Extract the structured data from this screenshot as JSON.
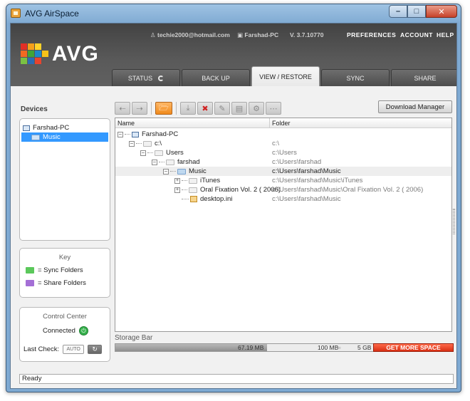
{
  "window": {
    "title": "AVG AirSpace"
  },
  "header": {
    "logo_text": "AVG",
    "account_email": "techie2000@hotmail.com",
    "computer_name": "Farshad-PC",
    "version": "V. 3.7.10770",
    "links": {
      "preferences": "PREFERENCES",
      "account": "ACCOUNT",
      "help": "HELP"
    }
  },
  "tabs": [
    {
      "label": "STATUS",
      "active": false
    },
    {
      "label": "BACK UP",
      "active": false
    },
    {
      "label": "VIEW / RESTORE",
      "active": true
    },
    {
      "label": "SYNC",
      "active": false
    },
    {
      "label": "SHARE",
      "active": false
    }
  ],
  "devices": {
    "label": "Devices",
    "items": [
      {
        "label": "Farshad-PC",
        "icon": "computer-icon",
        "selected": false
      },
      {
        "label": "Music",
        "icon": "folder-icon",
        "selected": true
      }
    ]
  },
  "key": {
    "title": "Key",
    "items": [
      {
        "label": "= Sync Folders",
        "color": "#5bc85b"
      },
      {
        "label": "= Share Folders",
        "color": "#a46fd6"
      }
    ]
  },
  "control_center": {
    "title": "Control Center",
    "status": "Connected",
    "last_check_label": "Last Check:",
    "auto_label": "AUTO"
  },
  "toolbar": {
    "download_manager": "Download Manager"
  },
  "listview": {
    "columns": [
      "Name",
      "Folder"
    ],
    "rows": [
      {
        "name": "Farshad-PC",
        "folder": "",
        "type": "computer",
        "selected": false
      },
      {
        "name": "c:\\",
        "folder": "c:\\",
        "type": "folder",
        "selected": false
      },
      {
        "name": "Users",
        "folder": "c:\\Users",
        "type": "folder",
        "selected": false
      },
      {
        "name": "farshad",
        "folder": "c:\\Users\\farshad",
        "type": "folder",
        "selected": false
      },
      {
        "name": "Music",
        "folder": "c:\\Users\\farshad\\Music",
        "type": "folder-blue",
        "selected": true
      },
      {
        "name": "iTunes",
        "folder": "c:\\Users\\farshad\\Music\\iTunes",
        "type": "folder",
        "selected": false
      },
      {
        "name": "Oral Fixation Vol. 2 ( 2006)",
        "folder": "c:\\Users\\farshad\\Music\\Oral Fixation Vol. 2 ( 2006)",
        "type": "folder",
        "selected": false
      },
      {
        "name": "desktop.ini",
        "folder": "c:\\Users\\farshad\\Music",
        "type": "file",
        "selected": false
      }
    ]
  },
  "storage": {
    "label": "Storage Bar",
    "used": "67.19 MB",
    "mid": "100 MB",
    "max": "5 GB",
    "used_fraction_of_bar": 0.45,
    "more_space": "GET MORE SPACE"
  },
  "statusbar": {
    "text": "Ready"
  }
}
